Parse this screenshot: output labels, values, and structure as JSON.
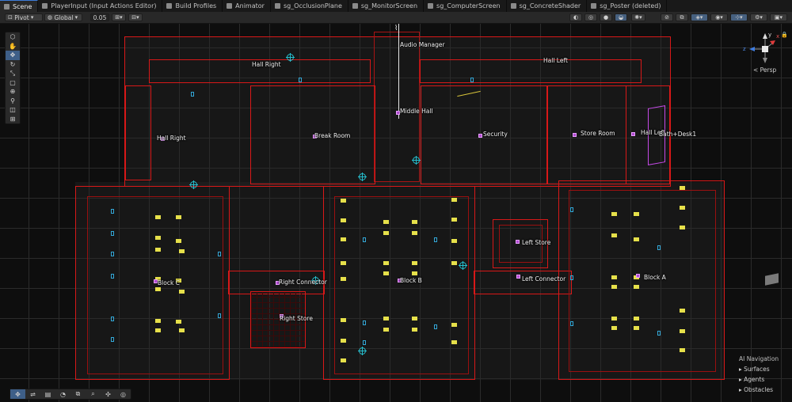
{
  "tabs": [
    {
      "label": "Scene",
      "active": true,
      "icon": "grid-icon"
    },
    {
      "label": "PlayerInput (Input Actions Editor)",
      "icon": "input-icon"
    },
    {
      "label": "Build Profiles",
      "icon": "build-icon"
    },
    {
      "label": "Animator",
      "icon": "animator-icon"
    },
    {
      "label": "sg_OcclusionPlane",
      "icon": "shader-graph-icon"
    },
    {
      "label": "sg_MonitorScreen",
      "icon": "shader-graph-icon"
    },
    {
      "label": "sg_ComputerScreen",
      "icon": "shader-graph-icon"
    },
    {
      "label": "sg_ConcreteShader",
      "icon": "shader-graph-icon"
    },
    {
      "label": "sg_Poster (deleted)",
      "icon": "shader-graph-icon"
    }
  ],
  "toolbar": {
    "pivot": "Pivot",
    "space": "Global",
    "snap_value": "0.05"
  },
  "scene_labels": {
    "audio_manager": "Audio Manager",
    "hall_right_top": "Hall Right",
    "hall_left_top": "Hall Left",
    "middle_hall": "Middle Hall",
    "hall_right": "Hall Right",
    "break_room": "Break Room",
    "security": "Security",
    "store_room": "Store Room",
    "hall_left": "Hall Left",
    "bath_desk": "Bath+Desk1",
    "left_store": "Left Store",
    "block_c": "Block C",
    "right_connector": "Right Connector",
    "block_b": "Block B",
    "left_connector": "Left Connector",
    "block_a": "Block A",
    "right_store": "Right Store"
  },
  "gizmo": {
    "projection": "< Persp",
    "x_label": "x",
    "y_label": "y",
    "z_label": "z"
  },
  "ai_navigation": {
    "title": "AI Navigation",
    "items": [
      "Surfaces",
      "Agents",
      "Obstacles"
    ]
  },
  "colors": {
    "wall": "#d81818",
    "desk": "#e6e04a",
    "marker": "#b14ad0",
    "camera": "#25c0d0",
    "accent": "#3e5f88"
  }
}
